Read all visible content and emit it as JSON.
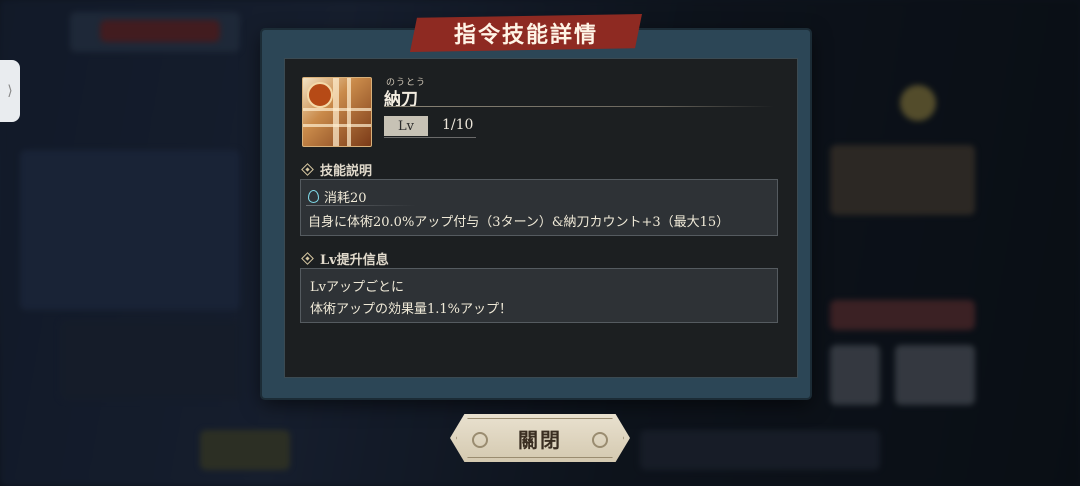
{
  "dialog": {
    "title": "指令技能詳情",
    "skill": {
      "name_ruby": "のうとう",
      "name": "納刀",
      "icon": "sheathe-sword-icon",
      "lv_label": "Lv",
      "lv_value": "1/10"
    },
    "description_section": {
      "heading": "技能説明",
      "cost_icon": "drop-icon",
      "cost_text": "消耗20",
      "text": "自身に体術20.0%アップ付与（3ターン）&納刀カウント+3（最大15）"
    },
    "levelup_section": {
      "heading": "Lv提升信息",
      "line1": "Lvアップごとに",
      "line2": "体術アップの効果量1.1%アップ！"
    },
    "close_label": "關閉"
  },
  "side_handle_glyph": "⟩",
  "colors": {
    "banner": "#8e2a22",
    "frame": "#2c4656",
    "panel": "#1c1f21",
    "info_box": "#2e3236",
    "cost_icon": "#7fd8e6"
  }
}
